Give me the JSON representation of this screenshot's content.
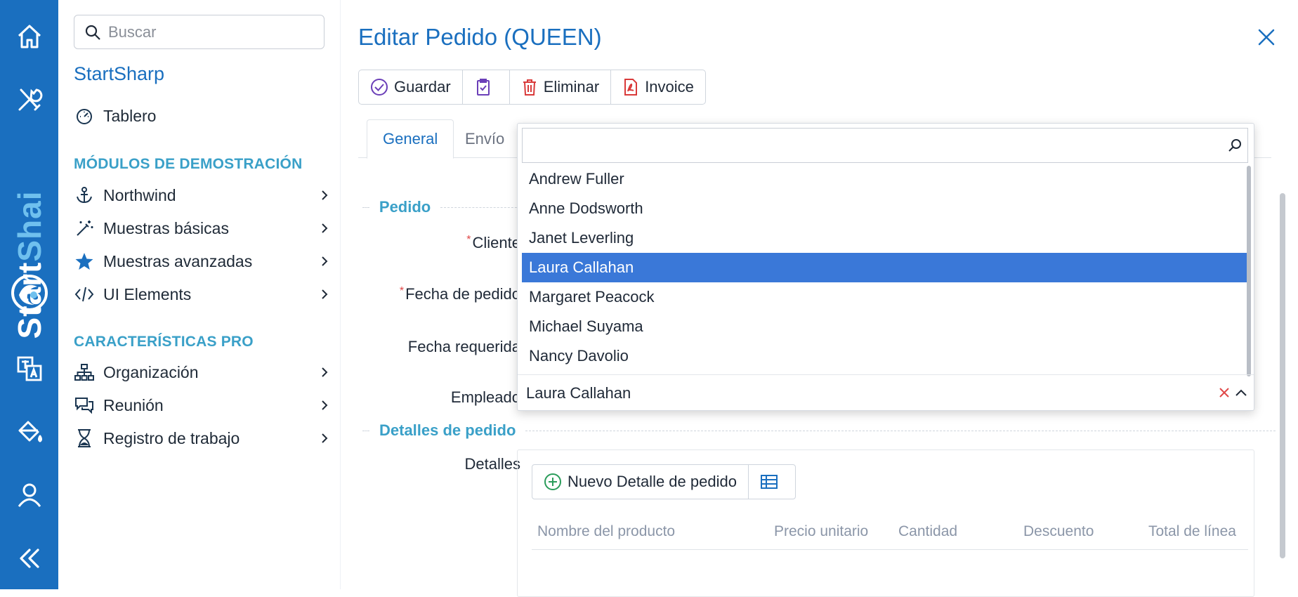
{
  "rail": {
    "items": [
      "home-icon",
      "tools-icon",
      "translate-icon",
      "paint-bucket-icon",
      "user-icon",
      "collapse-icon"
    ],
    "brand": {
      "part1": "Start",
      "part2": "Shai"
    },
    "color": "#1a6fbf"
  },
  "sidebar": {
    "search_placeholder": "Buscar",
    "app_title": "StartSharp",
    "dashboard": "Tablero",
    "section_demo": "MÓDULOS DE DEMOSTRACIÓN",
    "demo_items": [
      "Northwind",
      "Muestras básicas",
      "Muestras avanzadas",
      "UI Elements"
    ],
    "section_pro": "CARACTERÍSTICAS PRO",
    "pro_items": [
      "Organización",
      "Reunión",
      "Registro de trabajo"
    ]
  },
  "dialog": {
    "title": "Editar Pedido (QUEEN)",
    "toolbar": {
      "save": "Guardar",
      "delete": "Eliminar",
      "invoice": "Invoice"
    },
    "tabs": {
      "general": "General",
      "shipping": "Envío"
    },
    "section_order": "Pedido",
    "labels": {
      "customer": "Cliente",
      "order_date": "Fecha de pedido",
      "required_date": "Fecha requerida",
      "employee": "Empleado"
    },
    "employee_dropdown": {
      "options": [
        "Andrew Fuller",
        "Anne Dodsworth",
        "Janet Leverling",
        "Laura Callahan",
        "Margaret Peacock",
        "Michael Suyama",
        "Nancy Davolio"
      ],
      "selected": "Laura Callahan",
      "value": "Laura Callahan"
    },
    "section_details": "Detalles de pedido",
    "details_label": "Detalles",
    "new_detail_button": "Nuevo Detalle de pedido",
    "grid_columns": [
      "Nombre del producto",
      "Precio unitario",
      "Cantidad",
      "Descuento",
      "Total de línea"
    ]
  }
}
